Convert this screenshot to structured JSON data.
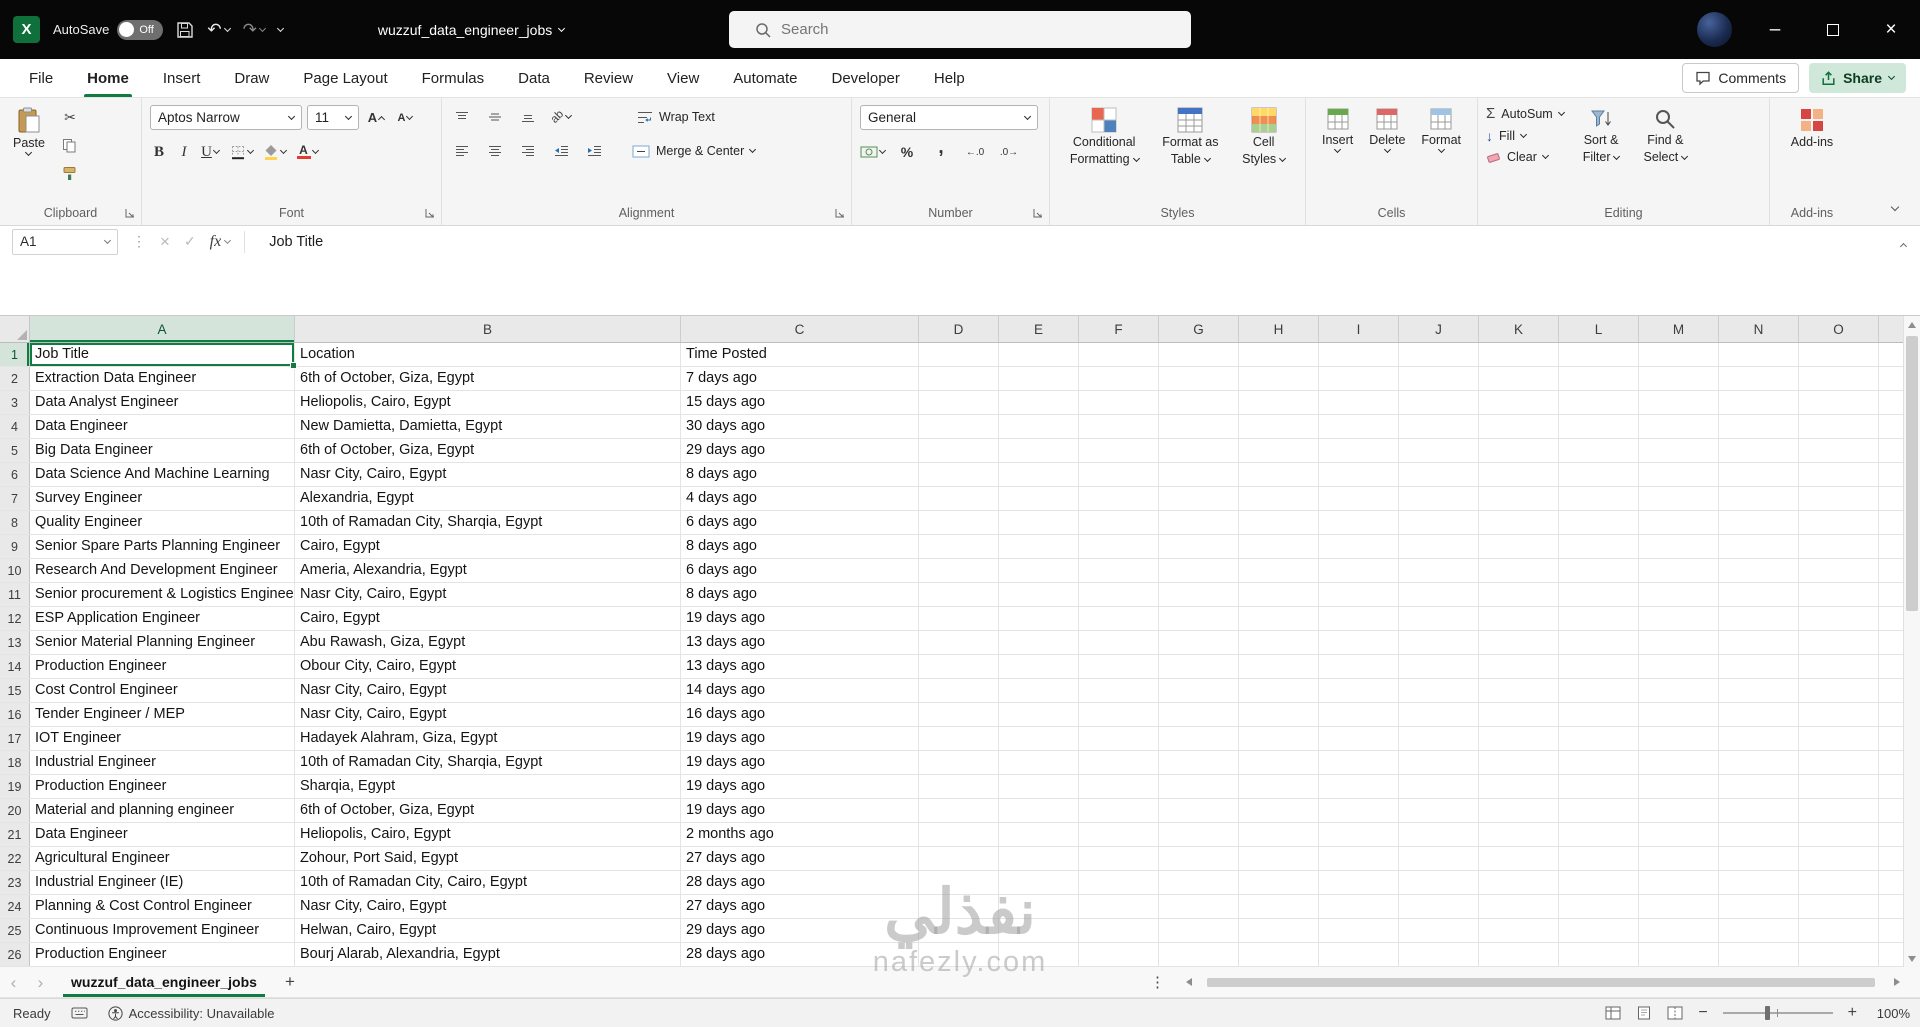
{
  "titlebar": {
    "autosave_label": "AutoSave",
    "autosave_state": "Off",
    "doc_title": "wuzzuf_data_engineer_jobs",
    "search_placeholder": "Search"
  },
  "ribbon_tabs": {
    "items": [
      "File",
      "Home",
      "Insert",
      "Draw",
      "Page Layout",
      "Formulas",
      "Data",
      "Review",
      "View",
      "Automate",
      "Developer",
      "Help"
    ],
    "active": "Home",
    "comments_label": "Comments",
    "share_label": "Share"
  },
  "ribbon": {
    "clipboard": {
      "label": "Clipboard",
      "paste": "Paste"
    },
    "font": {
      "label": "Font",
      "family": "Aptos Narrow",
      "size": "11"
    },
    "alignment": {
      "label": "Alignment",
      "wrap_text": "Wrap Text",
      "merge_center": "Merge & Center"
    },
    "number": {
      "label": "Number",
      "format": "General"
    },
    "styles": {
      "label": "Styles",
      "conditional_line1": "Conditional",
      "conditional_line2": "Formatting",
      "format_table_line1": "Format as",
      "format_table_line2": "Table",
      "cell_styles_line1": "Cell",
      "cell_styles_line2": "Styles"
    },
    "cells": {
      "label": "Cells",
      "insert": "Insert",
      "delete": "Delete",
      "format": "Format"
    },
    "editing": {
      "label": "Editing",
      "autosum": "AutoSum",
      "fill": "Fill",
      "clear": "Clear",
      "sort_line1": "Sort &",
      "sort_line2": "Filter",
      "find_line1": "Find &",
      "find_line2": "Select"
    },
    "addins": {
      "label": "Add-ins",
      "button": "Add-ins"
    }
  },
  "formula_bar": {
    "name_box": "A1",
    "fx": "fx",
    "value": "Job Title"
  },
  "grid": {
    "columns": [
      "A",
      "B",
      "C",
      "D",
      "E",
      "F",
      "G",
      "H",
      "I",
      "J",
      "K",
      "L",
      "M",
      "N",
      "O"
    ],
    "selected_cell": "A1",
    "rows": [
      {
        "n": 1,
        "a": "Job Title",
        "b": "Location",
        "c": "Time Posted"
      },
      {
        "n": 2,
        "a": "Extraction Data Engineer",
        "b": "6th of October, Giza, Egypt",
        "c": "7 days ago"
      },
      {
        "n": 3,
        "a": "Data Analyst Engineer",
        "b": "Heliopolis, Cairo, Egypt",
        "c": "15 days ago"
      },
      {
        "n": 4,
        "a": "Data Engineer",
        "b": "New Damietta, Damietta, Egypt",
        "c": "30 days ago"
      },
      {
        "n": 5,
        "a": "Big Data Engineer",
        "b": "6th of October, Giza, Egypt",
        "c": "29 days ago"
      },
      {
        "n": 6,
        "a": "Data Science And Machine Learning",
        "b": "Nasr City, Cairo, Egypt",
        "c": "8 days ago"
      },
      {
        "n": 7,
        "a": "Survey Engineer",
        "b": "Alexandria, Egypt",
        "c": "4 days ago"
      },
      {
        "n": 8,
        "a": "Quality Engineer",
        "b": "10th of Ramadan City, Sharqia, Egypt",
        "c": "6 days ago"
      },
      {
        "n": 9,
        "a": "Senior Spare Parts Planning Engineer",
        "b": "Cairo, Egypt",
        "c": "8 days ago"
      },
      {
        "n": 10,
        "a": "Research And Development Engineer",
        "b": "Ameria, Alexandria, Egypt",
        "c": "6 days ago"
      },
      {
        "n": 11,
        "a": "Senior procurement & Logistics Engineer",
        "b": "Nasr City, Cairo, Egypt",
        "c": "8 days ago"
      },
      {
        "n": 12,
        "a": "ESP Application Engineer",
        "b": "Cairo, Egypt",
        "c": "19 days ago"
      },
      {
        "n": 13,
        "a": "Senior Material Planning Engineer",
        "b": "Abu Rawash, Giza, Egypt",
        "c": "13 days ago"
      },
      {
        "n": 14,
        "a": "Production Engineer",
        "b": "Obour City, Cairo, Egypt",
        "c": "13 days ago"
      },
      {
        "n": 15,
        "a": "Cost Control Engineer",
        "b": "Nasr City, Cairo, Egypt",
        "c": "14 days ago"
      },
      {
        "n": 16,
        "a": "Tender Engineer / MEP",
        "b": "Nasr City, Cairo, Egypt",
        "c": "16 days ago"
      },
      {
        "n": 17,
        "a": "IOT Engineer",
        "b": "Hadayek Alahram, Giza, Egypt",
        "c": "19 days ago"
      },
      {
        "n": 18,
        "a": "Industrial Engineer",
        "b": "10th of Ramadan City, Sharqia, Egypt",
        "c": "19 days ago"
      },
      {
        "n": 19,
        "a": "Production Engineer",
        "b": "Sharqia, Egypt",
        "c": "19 days ago"
      },
      {
        "n": 20,
        "a": "Material and planning engineer",
        "b": "6th of October, Giza, Egypt",
        "c": "19 days ago"
      },
      {
        "n": 21,
        "a": "Data Engineer",
        "b": "Heliopolis, Cairo, Egypt",
        "c": "2 months ago"
      },
      {
        "n": 22,
        "a": "Agricultural Engineer",
        "b": "Zohour, Port Said, Egypt",
        "c": "27 days ago"
      },
      {
        "n": 23,
        "a": "Industrial Engineer (IE)",
        "b": "10th of Ramadan City, Cairo, Egypt",
        "c": "28 days ago"
      },
      {
        "n": 24,
        "a": "Planning & Cost Control Engineer",
        "b": "Nasr City, Cairo, Egypt",
        "c": "27 days ago"
      },
      {
        "n": 25,
        "a": "Continuous Improvement Engineer",
        "b": "Helwan, Cairo, Egypt",
        "c": "29 days ago"
      },
      {
        "n": 26,
        "a": "Production Engineer",
        "b": "Bourj Alarab, Alexandria, Egypt",
        "c": "28 days ago"
      }
    ]
  },
  "sheet_bar": {
    "tab": "wuzzuf_data_engineer_jobs"
  },
  "status_bar": {
    "ready": "Ready",
    "accessibility": "Accessibility: Unavailable",
    "zoom": "100%"
  },
  "watermark": {
    "line1": "نفذلي",
    "line2": "nafezly.com"
  },
  "icons": {
    "excel_logo": "X",
    "undo": "↶",
    "redo": "↷",
    "minimize": "–",
    "close": "×",
    "cut": "✂",
    "bold": "B",
    "italic": "I",
    "underline": "U",
    "font_grow": "A",
    "font_shrink": "A",
    "orientation": "ab",
    "percent": "%",
    "comma": ",",
    "increase_decimal": "←.0",
    "decrease_decimal": ".0→",
    "autosum_glyph": "Σ",
    "fill_glyph": "↓",
    "cancel": "×",
    "enter": "✓",
    "more_vert": "⋮",
    "nav_prev": "‹",
    "nav_next": "›",
    "add_sheet": "+"
  }
}
